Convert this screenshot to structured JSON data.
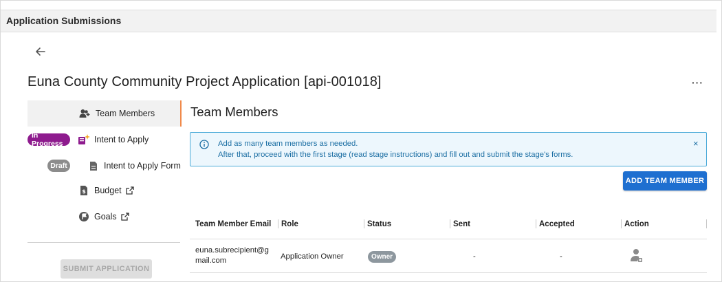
{
  "window": {
    "title": "Application Submissions"
  },
  "page": {
    "title": "Euna County Community Project Application [api-001018]",
    "more_label": "···"
  },
  "sidebar": {
    "items": [
      {
        "label": "Team Members",
        "icon": "team-add-icon",
        "active": true
      },
      {
        "label": "Intent to Apply",
        "icon": "intent-sparkle-icon",
        "badge": "In Progress"
      },
      {
        "label": "Intent to Apply Form",
        "icon": "document-icon",
        "badge": "Draft"
      },
      {
        "label": "Budget",
        "icon": "budget-doc-icon",
        "external": true
      },
      {
        "label": "Goals",
        "icon": "flag-circle-icon",
        "external": true
      }
    ],
    "submit_label": "SUBMIT APPLICATION"
  },
  "main": {
    "section_title": "Team Members",
    "info": {
      "line1": "Add as many team members as needed.",
      "line2": "After that, proceed with the first stage (read stage instructions) and fill out and submit the stage's forms.",
      "close": "×"
    },
    "add_button_label": "ADD TEAM MEMBER",
    "table": {
      "headers": [
        "Team Member Email",
        "Role",
        "Status",
        "Sent",
        "Accepted",
        "Action"
      ],
      "rows": [
        {
          "email_line1": "euna.subrecipient@g",
          "email_line2": "mail.com",
          "role": "Application Owner",
          "status": "Owner",
          "sent": "-",
          "accepted": "-",
          "action_icon": "user-settings-icon"
        }
      ]
    }
  },
  "colors": {
    "accent": "#1e6fd0",
    "active_marker": "#f08a4b",
    "in_progress": "#8e1b8e",
    "draft": "#8c8c8c",
    "info_border": "#4aaad8",
    "info_bg": "#edf7fd"
  }
}
